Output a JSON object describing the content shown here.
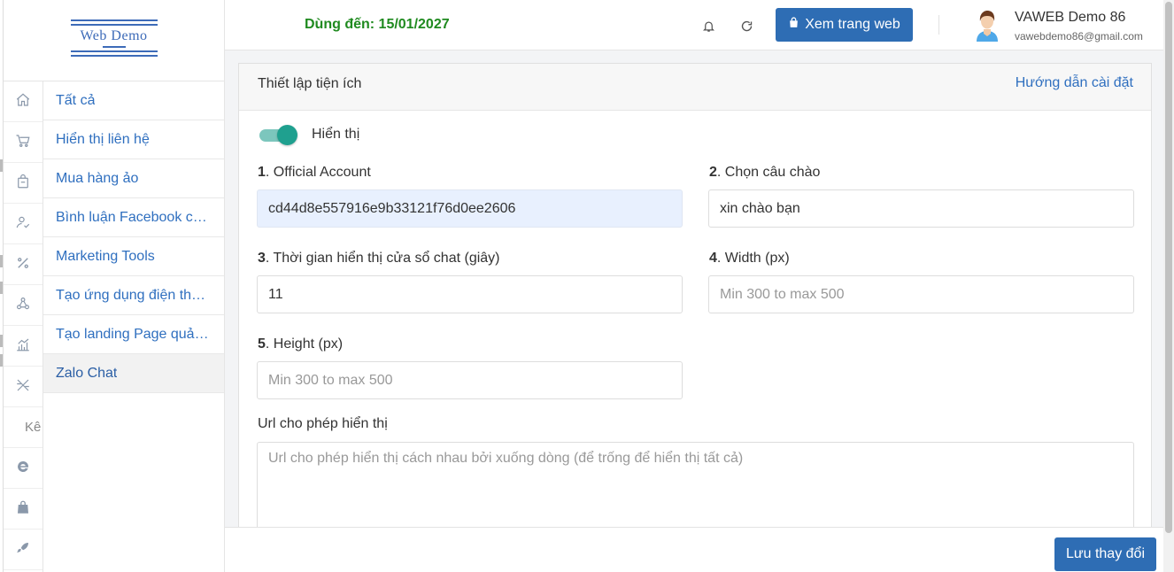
{
  "logo": {
    "text": "Web Demo"
  },
  "rail": {
    "items": [
      {
        "icon": "home-icon"
      },
      {
        "icon": "cart-icon"
      },
      {
        "icon": "bag-icon"
      },
      {
        "icon": "user-check-icon"
      },
      {
        "icon": "percent-icon"
      },
      {
        "icon": "network-icon"
      },
      {
        "icon": "chart-icon"
      },
      {
        "icon": "tools-icon"
      }
    ],
    "text_item": "Kê",
    "bottom_items": [
      {
        "icon": "internet-explorer-icon"
      },
      {
        "icon": "shopping-bag-icon"
      },
      {
        "icon": "rocket-icon"
      }
    ]
  },
  "submenu": {
    "items": [
      {
        "label": "Tất cả"
      },
      {
        "label": "Hiển thị liên hệ"
      },
      {
        "label": "Mua hàng ảo"
      },
      {
        "label": "Bình luận Facebook ch…"
      },
      {
        "label": "Marketing Tools"
      },
      {
        "label": "Tạo ứng dụng điện tho…"
      },
      {
        "label": "Tạo landing Page quả…"
      },
      {
        "label": "Zalo Chat",
        "active": true
      }
    ]
  },
  "header": {
    "expiry": "Dùng đến: 15/01/2027",
    "view_site_label": "Xem trang web",
    "user_name": "VAWEB Demo 86",
    "user_email": "vawebdemo86@gmail.com"
  },
  "card": {
    "title": "Thiết lập tiện ích",
    "guide_link": "Hướng dẫn cài đặt",
    "toggle_label": "Hiển thị",
    "toggle_on": true,
    "fields": {
      "f1": {
        "num": "1",
        "label": ". Official Account",
        "value": "cd44d8e557916e9b33121f76d0ee2606"
      },
      "f2": {
        "num": "2",
        "label": ". Chọn câu chào",
        "value": "xin chào bạn"
      },
      "f3": {
        "num": "3",
        "label": ". Thời gian hiển thị cửa sổ chat (giây)",
        "value": "11"
      },
      "f4": {
        "num": "4",
        "label": ". Width (px)",
        "placeholder": "Min 300 to max 500"
      },
      "f5": {
        "num": "5",
        "label": ". Height (px)",
        "placeholder": "Min 300 to max 500"
      },
      "url": {
        "label": "Url cho phép hiển thị",
        "placeholder": "Url cho phép hiển thị cách nhau bởi xuống dòng (để trống để hiển thị tất cả)"
      }
    }
  },
  "footer": {
    "save_label": "Lưu thay đổi"
  },
  "colors": {
    "primary": "#2e6db4",
    "link": "#2f6fbf",
    "expiry": "#1f8a1f",
    "toggle": "#1fa08f"
  }
}
